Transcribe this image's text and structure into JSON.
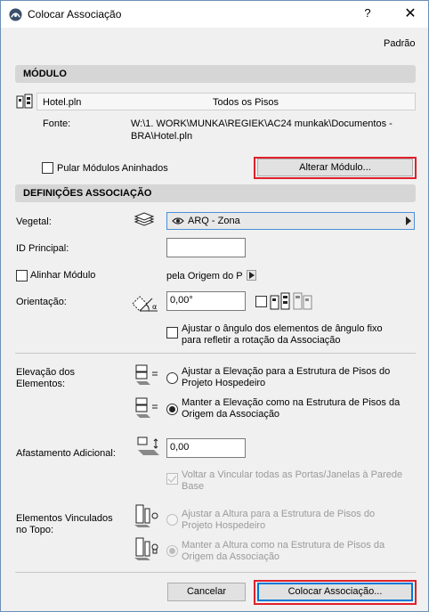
{
  "window": {
    "title": "Colocar Associação",
    "help": "?",
    "close": "✕"
  },
  "default_link": "Padrão",
  "modulo": {
    "header": "MÓDULO",
    "file_name": "Hotel.pln",
    "floors": "Todos os Pisos",
    "source_label": "Fonte:",
    "source_path_line1": "W:\\1. WORK\\MUNKA\\REGIEK\\AC24 munkak\\Documentos -",
    "source_path_line2": "BRA\\Hotel.pln",
    "skip_nested_label": "Pular Módulos Aninhados",
    "change_module_button": "Alterar Módulo..."
  },
  "definicoes": {
    "header": "DEFINIÇÕES ASSOCIAÇÃO",
    "vegetal_label": "Vegetal:",
    "layer_value": "ARQ - Zona",
    "id_label": "ID Principal:",
    "id_value": "",
    "align_label": "Alinhar Módulo",
    "align_value": "pela Origem do P",
    "orientation_label": "Orientação:",
    "orientation_value": "0,00°",
    "adjust_angle_line1": "Ajustar o ângulo dos elementos de ângulo fixo",
    "adjust_angle_line2": "para refletir a rotação da Associação"
  },
  "elevacao": {
    "label_line1": "Elevação dos",
    "label_line2": "Elementos:",
    "opt1_line1": "Ajustar a Elevação para a Estrutura de Pisos do",
    "opt1_line2": "Projeto Hospedeiro",
    "opt2_line1": "Manter a Elevação como na Estrutura de Pisos da",
    "opt2_line2": "Origem da Associação"
  },
  "afastamento": {
    "label": "Afastamento Adicional:",
    "value": "0,00",
    "reconnect_line1": "Voltar a Vincular todas as Portas/Janelas à Parede",
    "reconnect_line2": "Base"
  },
  "topo": {
    "label_line1": "Elementos Vinculados",
    "label_line2": "no Topo:",
    "opt1_line1": "Ajustar a Altura para a Estrutura de Pisos do",
    "opt1_line2": "Projeto Hospedeiro",
    "opt2_line1": "Manter a Altura como na Estrutura de Pisos da",
    "opt2_line2": "Origem da Associação"
  },
  "footer": {
    "cancel": "Cancelar",
    "place": "Colocar Associação..."
  },
  "colors": {
    "highlight": "#e0202b",
    "accent": "#0078d7"
  },
  "state": {
    "skip_nested_checked": false,
    "align_checked": false,
    "adjust_angle_checked": false,
    "elevation_selected": "opt2",
    "reconnect_checked": true,
    "top_selected": "opt2"
  }
}
